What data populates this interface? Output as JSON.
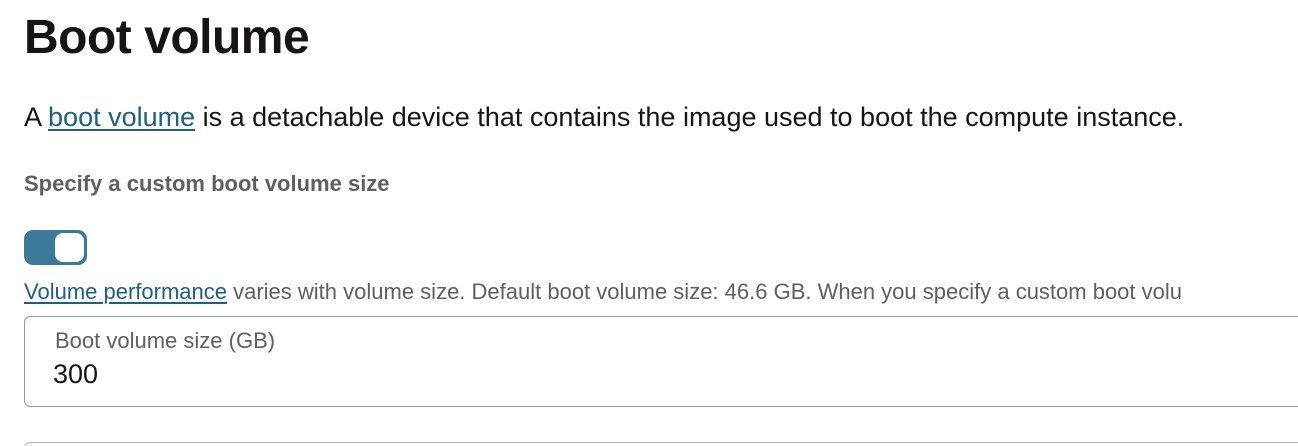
{
  "heading": "Boot volume",
  "description": {
    "prefix": "A ",
    "link": "boot volume",
    "suffix": " is a detachable device that contains the image used to boot the compute instance."
  },
  "custom_size": {
    "label": "Specify a custom boot volume size",
    "toggle_on": true,
    "toggle_color": "#3d7a99"
  },
  "performance_note": {
    "link": "Volume performance",
    "text": " varies with volume size. Default boot volume size: 46.6 GB. When you specify a custom boot volu"
  },
  "size_field": {
    "label": "Boot volume size (GB)",
    "value": "300"
  }
}
